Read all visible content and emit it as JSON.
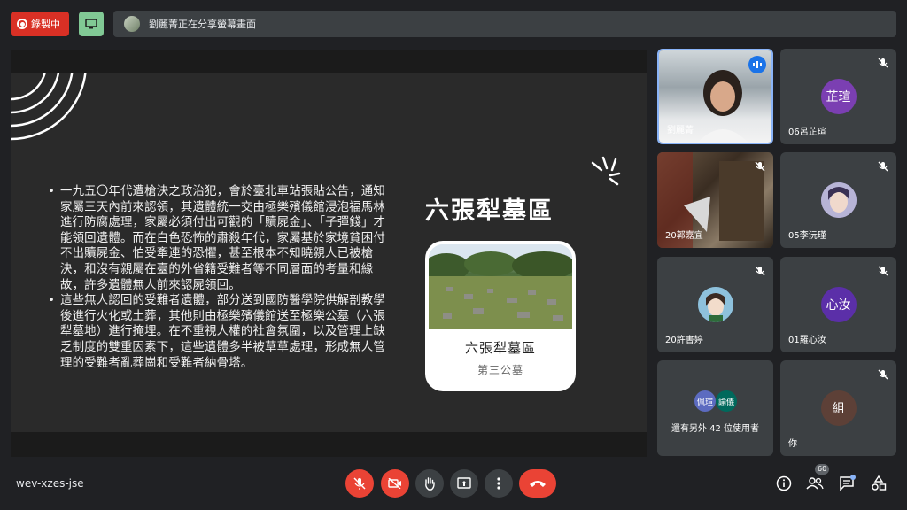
{
  "top": {
    "record_label": "錄製中",
    "share_text": "劉麗菁正在分享螢幕畫面"
  },
  "slide": {
    "bullets": [
      "一九五〇年代遭槍決之政治犯，會於臺北車站張貼公告，通知家屬三天內前來認領，其遺體統一交由極樂殯儀館浸泡福馬林進行防腐處理，家屬必須付出可觀的「贖屍金」、「子彈錢」才能領回遺體。而在白色恐怖的肅殺年代，家屬基於家境貧困付不出贖屍金、怕受牽連的恐懼，甚至根本不知曉親人已被槍決，和沒有親屬在臺的外省籍受難者等不同層面的考量和緣故，許多遺體無人前來認屍領回。",
      "這些無人認回的受難者遺體，部分送到國防醫學院供解剖教學後進行火化或土葬，其他則由極樂殯儀館送至極樂公墓（六張犁墓地）進行掩埋。在不重視人權的社會氛圍，以及管理上缺乏制度的雙重因素下，這些遺體多半被草草處理，形成無人管理的受難者亂葬崗和受難者納骨塔。"
    ],
    "title": "六張犁墓區",
    "card_title": "六張犁墓區",
    "card_subtitle": "第三公墓"
  },
  "participants": [
    {
      "name": "劉麗菁",
      "type": "video-1",
      "speaking": true
    },
    {
      "name": "06呂芷瑄",
      "type": "avatar",
      "avatar_text": "芷瑄",
      "avatar_color": "#7b3fb2"
    },
    {
      "name": "20郭嘉宜",
      "type": "video-2"
    },
    {
      "name": "05李沅瑾",
      "type": "avatar-img",
      "avatar_color": "#8a7cc2"
    },
    {
      "name": "20許書婷",
      "type": "avatar-img",
      "avatar_color": "#6fa3c4"
    },
    {
      "name": "01羅心汝",
      "type": "avatar",
      "avatar_text": "心汝",
      "avatar_color": "#5b2fa8"
    },
    {
      "name": "還有另外 42 位使用者",
      "type": "more",
      "minis": [
        "佩瑄",
        "諭儀"
      ]
    },
    {
      "name": "你",
      "type": "avatar",
      "avatar_text": "組",
      "avatar_color": "#5d4037"
    }
  ],
  "bottom": {
    "meeting_code": "wev-xzes-jse",
    "people_count": "60"
  },
  "colors": {
    "background": "#202124",
    "tile": "#3c4043",
    "red": "#ea4335",
    "record": "#d93025",
    "share_green": "#81c995",
    "active_border": "#8ab4f8"
  }
}
